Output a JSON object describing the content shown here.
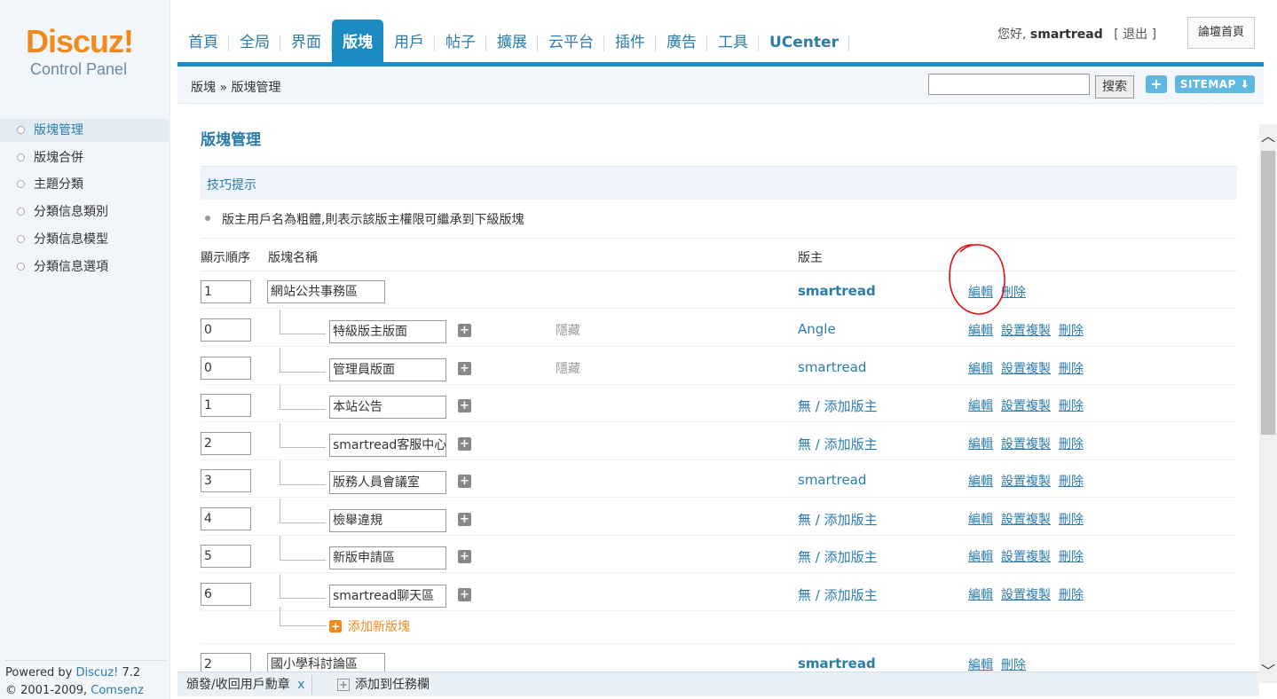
{
  "logo": {
    "brand": "Discuz!",
    "sub": "Control Panel"
  },
  "nav": [
    {
      "label": "首頁",
      "active": false
    },
    {
      "label": "全局",
      "active": false
    },
    {
      "label": "界面",
      "active": false
    },
    {
      "label": "版塊",
      "active": true
    },
    {
      "label": "用戶",
      "active": false
    },
    {
      "label": "帖子",
      "active": false
    },
    {
      "label": "擴展",
      "active": false
    },
    {
      "label": "云平台",
      "active": false
    },
    {
      "label": "插件",
      "active": false
    },
    {
      "label": "廣告",
      "active": false
    },
    {
      "label": "工具",
      "active": false
    },
    {
      "label": "UCenter",
      "active": false
    }
  ],
  "user": {
    "greeting": "您好,",
    "name": "smartread",
    "logout": "[ 退出 ]",
    "forum_home": "論壇首頁"
  },
  "breadcrumb": "版塊 » 版塊管理",
  "search": {
    "button": "搜索",
    "plus": "+",
    "sitemap": "SITEMAP ⬇"
  },
  "sidebar": {
    "items": [
      {
        "label": "版塊管理",
        "active": true
      },
      {
        "label": "版塊合併",
        "active": false
      },
      {
        "label": "主題分類",
        "active": false
      },
      {
        "label": "分類信息類別",
        "active": false
      },
      {
        "label": "分類信息模型",
        "active": false
      },
      {
        "label": "分類信息選項",
        "active": false
      }
    ],
    "footer_powered": "Powered by",
    "footer_product": "Discuz!",
    "footer_version": "7.2",
    "footer_copyright": "© 2001-2009,",
    "footer_company": "Comsenz Inc."
  },
  "main": {
    "title": "版塊管理",
    "tips_title": "技巧提示",
    "tip": "版主用戶名為粗體,則表示該版主權限可繼承到下級版塊",
    "columns": {
      "order": "顯示順序",
      "name": "版塊名稱",
      "moderator": "版主"
    },
    "add_forum": "添加新版塊",
    "rows": [
      {
        "type": "group",
        "order": "1",
        "name": "網站公共事務區",
        "hidden": "",
        "moderator": "smartread",
        "actions": [
          "編輯",
          "刪除"
        ]
      },
      {
        "type": "forum",
        "order": "0",
        "name": "特級版主版面",
        "hidden": "隱藏",
        "moderator": "Angle",
        "actions": [
          "編輯",
          "設置複製",
          "刪除"
        ]
      },
      {
        "type": "forum",
        "order": "0",
        "name": "管理員版面",
        "hidden": "隱藏",
        "moderator": "smartread",
        "actions": [
          "編輯",
          "設置複製",
          "刪除"
        ]
      },
      {
        "type": "forum",
        "order": "1",
        "name": "本站公告",
        "hidden": "",
        "moderator": "無 / 添加版主",
        "actions": [
          "編輯",
          "設置複製",
          "刪除"
        ]
      },
      {
        "type": "forum",
        "order": "2",
        "name": "smartread客服中心",
        "hidden": "",
        "moderator": "無 / 添加版主",
        "actions": [
          "編輯",
          "設置複製",
          "刪除"
        ]
      },
      {
        "type": "forum",
        "order": "3",
        "name": "版務人員會議室",
        "hidden": "",
        "moderator": "smartread",
        "actions": [
          "編輯",
          "設置複製",
          "刪除"
        ]
      },
      {
        "type": "forum",
        "order": "4",
        "name": "檢舉違規",
        "hidden": "",
        "moderator": "無 / 添加版主",
        "actions": [
          "編輯",
          "設置複製",
          "刪除"
        ]
      },
      {
        "type": "forum",
        "order": "5",
        "name": "新版申請區",
        "hidden": "",
        "moderator": "無 / 添加版主",
        "actions": [
          "編輯",
          "設置複製",
          "刪除"
        ]
      },
      {
        "type": "forum",
        "order": "6",
        "name": "smartread聊天區",
        "hidden": "",
        "moderator": "無 / 添加版主",
        "actions": [
          "編輯",
          "設置複製",
          "刪除"
        ]
      },
      {
        "type": "group",
        "order": "2",
        "name": "國小學科討論區",
        "hidden": "",
        "moderator": "smartread",
        "actions": [
          "編輯",
          "刪除"
        ]
      }
    ]
  },
  "taskbar": {
    "task1": "頒發/收回用戶勳章",
    "task1_close": "x",
    "task2": "添加到任務欄"
  },
  "colors": {
    "accent": "#1b8bc2",
    "brand_orange": "#f08a1c",
    "link": "#2b7cab"
  }
}
